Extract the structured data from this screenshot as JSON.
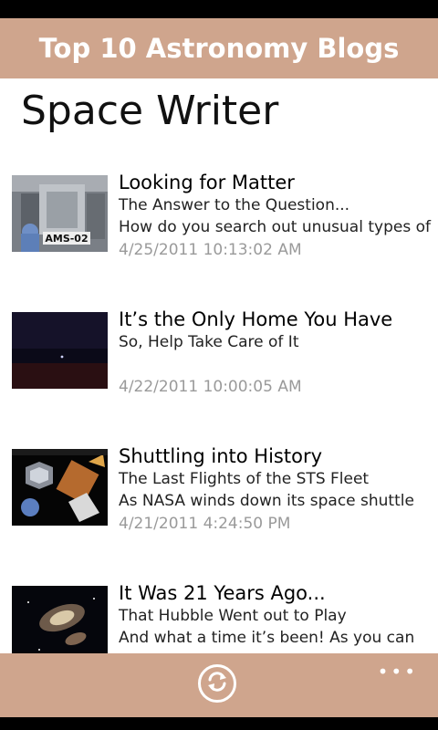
{
  "header": {
    "title": "Top 10 Astronomy Blogs"
  },
  "page": {
    "title": "Space Writer"
  },
  "posts": [
    {
      "title": "Looking for Matter",
      "subtitle": "The Answer to the Question...",
      "excerpt": "How do you search out unusual types of",
      "date": "4/25/2011 10:13:02 AM",
      "thumb_label": "AMS-02"
    },
    {
      "title": "It’s the Only Home You Have",
      "subtitle": "So, Help Take Care of It",
      "excerpt": "",
      "date": "4/22/2011 10:00:05 AM"
    },
    {
      "title": "Shuttling into History",
      "subtitle": "The Last Flights of the STS Fleet",
      "excerpt": "As NASA winds down its space shuttle",
      "date": "4/21/2011 4:24:50 PM"
    },
    {
      "title": "It Was 21 Years Ago...",
      "subtitle": "That Hubble Went out to Play",
      "excerpt": "And what a time it’s been!  As you can",
      "date": ""
    }
  ],
  "appbar": {
    "refresh_icon": "refresh-icon",
    "more_label": "•••"
  },
  "colors": {
    "accent": "#CFA58D"
  }
}
